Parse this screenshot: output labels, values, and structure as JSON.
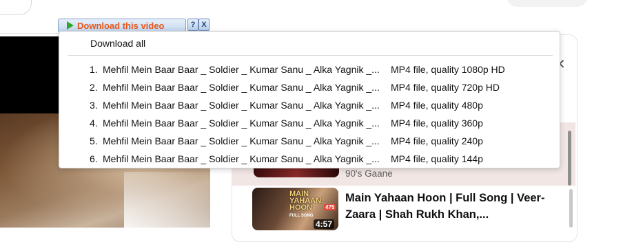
{
  "downloader": {
    "button_label": "Download this video",
    "help_label": "?",
    "close_label": "X",
    "download_all": "Download all",
    "items": [
      {
        "num": "1.",
        "title": "Mehfil Mein Baar Baar _ Soldier _ Kumar Sanu _ Alka Yagnik _...",
        "format": "MP4 file, quality 1080p HD"
      },
      {
        "num": "2.",
        "title": "Mehfil Mein Baar Baar _ Soldier _ Kumar Sanu _ Alka Yagnik _...",
        "format": "MP4 file, quality 720p HD"
      },
      {
        "num": "3.",
        "title": "Mehfil Mein Baar Baar _ Soldier _ Kumar Sanu _ Alka Yagnik _...",
        "format": "MP4 file, quality 480p"
      },
      {
        "num": "4.",
        "title": "Mehfil Mein Baar Baar _ Soldier _ Kumar Sanu _ Alka Yagnik _...",
        "format": "MP4 file, quality 360p"
      },
      {
        "num": "5.",
        "title": "Mehfil Mein Baar Baar _ Soldier _ Kumar Sanu _ Alka Yagnik _...",
        "format": "MP4 file, quality 240p"
      },
      {
        "num": "6.",
        "title": "Mehfil Mein Baar Baar _ Soldier _ Kumar Sanu _ Alka Yagnik _...",
        "format": "MP4 file, quality 144p"
      }
    ]
  },
  "playlist": {
    "close_icon": "close-icon",
    "current_channel": "90's Gaane",
    "next_video": {
      "title": "Main Yahaan Hoon | Full Song | Veer-Zaara | Shah Rukh Khan,...",
      "thumb_title": "MAIN YAHAAN HOON",
      "thumb_badge": "475",
      "thumb_tag": "FULL SONG",
      "duration": "4:57"
    }
  },
  "colors": {
    "button_text": "#e8571b",
    "play_icon": "#2fa82a",
    "playing_row": "#f1e6e3"
  }
}
